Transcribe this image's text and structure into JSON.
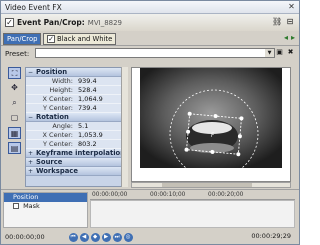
{
  "window": {
    "title": "Video Event FX"
  },
  "header": {
    "plugin_name": "Event Pan/Crop:",
    "clip_name": "MVI_8829"
  },
  "tabs": [
    {
      "label": "Pan/Crop"
    },
    {
      "label": "Black and White"
    }
  ],
  "preset": {
    "label": "Preset:",
    "value": ""
  },
  "properties": {
    "position": {
      "title": "Position",
      "rows": [
        {
          "name": "Width:",
          "value": "939.4"
        },
        {
          "name": "Height:",
          "value": "528.4"
        },
        {
          "name": "X Center:",
          "value": "1,064.9"
        },
        {
          "name": "Y Center:",
          "value": "739.4"
        }
      ]
    },
    "rotation": {
      "title": "Rotation",
      "rows": [
        {
          "name": "Angle:",
          "value": "5.1"
        },
        {
          "name": "X Center:",
          "value": "1,053.9"
        },
        {
          "name": "Y Center:",
          "value": "803.2"
        }
      ]
    },
    "collapsed": [
      {
        "title": "Keyframe interpolation"
      },
      {
        "title": "Source"
      },
      {
        "title": "Workspace"
      }
    ]
  },
  "timeline": {
    "tracks": [
      {
        "label": "Position"
      },
      {
        "label": "Mask"
      }
    ],
    "ruler": [
      "00:00:00;00",
      "00:00:10;00",
      "00:00:20;00"
    ],
    "timecode_left": "00:00:00;00",
    "timecode_right": "00:00:29;29"
  },
  "colors": {
    "accent": "#3f6fb4",
    "section": "#c8d4e8"
  }
}
